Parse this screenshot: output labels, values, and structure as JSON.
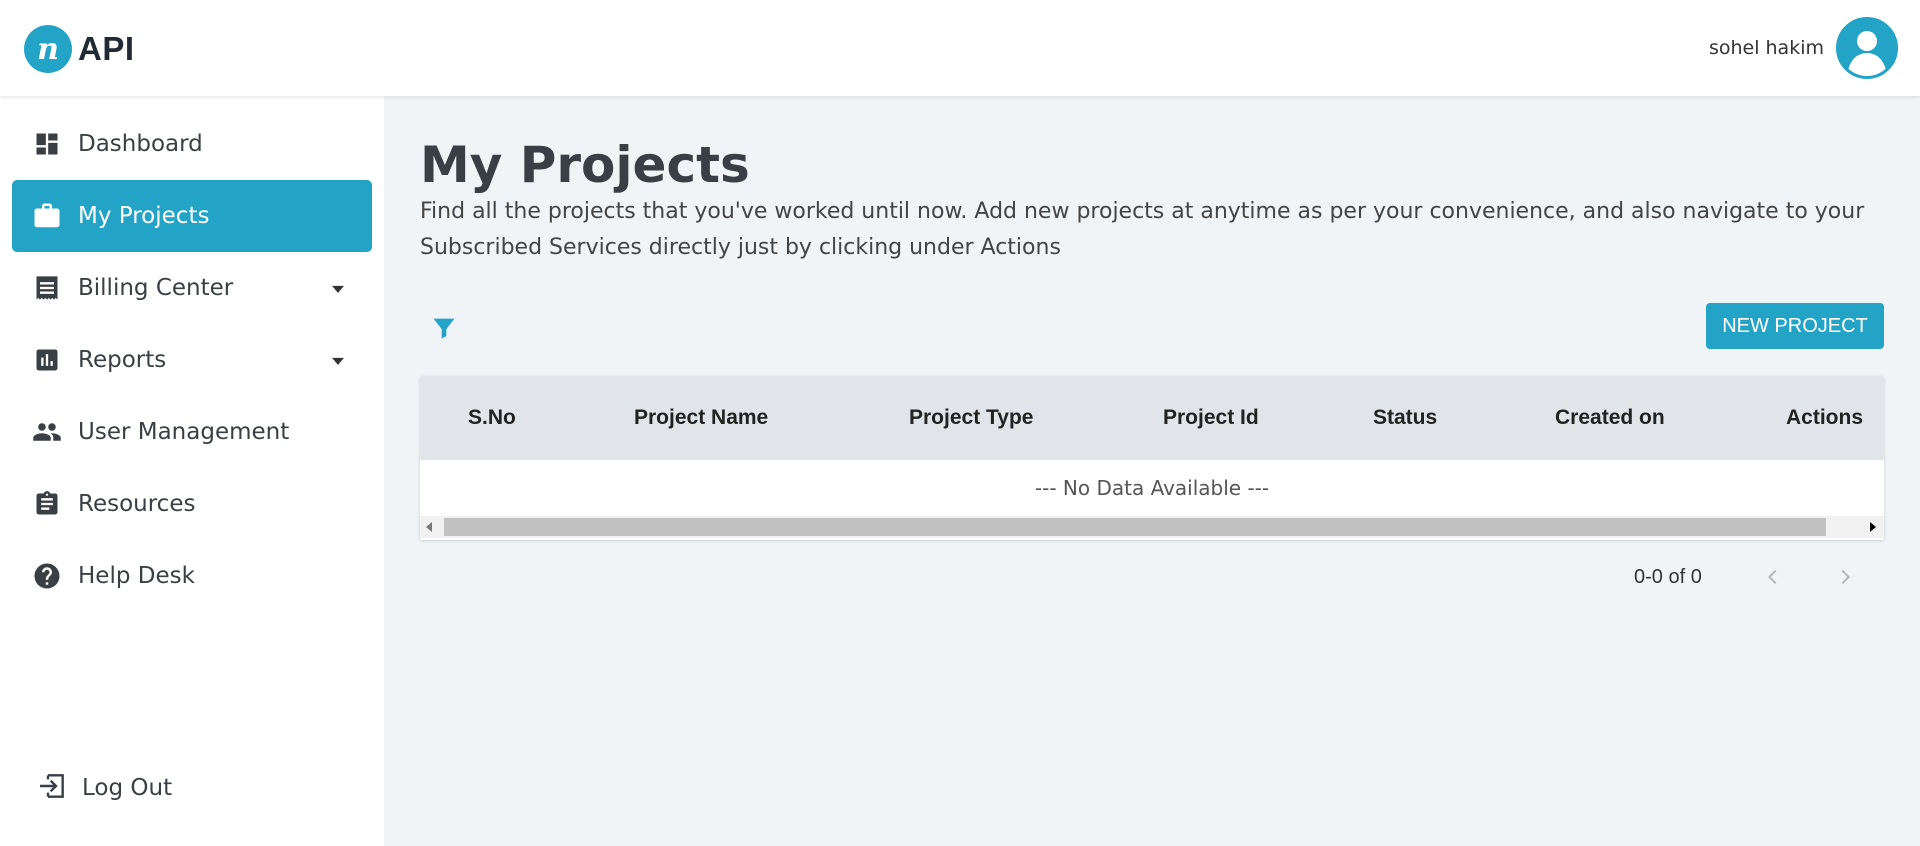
{
  "header": {
    "logo_text": "API",
    "logo_glyph": "n",
    "user_name": "sohel hakim",
    "accent_color": "#23a3c6"
  },
  "sidebar": {
    "items": [
      {
        "label": "Dashboard",
        "icon": "dashboard-icon",
        "active": false,
        "has_caret": false
      },
      {
        "label": "My Projects",
        "icon": "briefcase-icon",
        "active": true,
        "has_caret": false
      },
      {
        "label": "Billing Center",
        "icon": "receipt-icon",
        "active": false,
        "has_caret": true
      },
      {
        "label": "Reports",
        "icon": "bar-chart-icon",
        "active": false,
        "has_caret": true
      },
      {
        "label": "User Management",
        "icon": "people-icon",
        "active": false,
        "has_caret": false
      },
      {
        "label": "Resources",
        "icon": "clipboard-icon",
        "active": false,
        "has_caret": false
      },
      {
        "label": "Help Desk",
        "icon": "help-icon",
        "active": false,
        "has_caret": false
      }
    ],
    "logout_label": "Log Out"
  },
  "main": {
    "title": "My Projects",
    "description": "Find all the projects that you've worked until now. Add new projects at anytime as per your convenience, and also navigate to your Subscribed Services directly just by clicking under Actions",
    "new_project_label": "NEW PROJECT",
    "table": {
      "columns": [
        "S.No",
        "Project Name",
        "Project Type",
        "Project Id",
        "Status",
        "Created on",
        "Actions"
      ],
      "rows": [],
      "empty_text": "--- No Data Available ---"
    },
    "pagination": {
      "range_text": "0-0 of 0"
    }
  }
}
